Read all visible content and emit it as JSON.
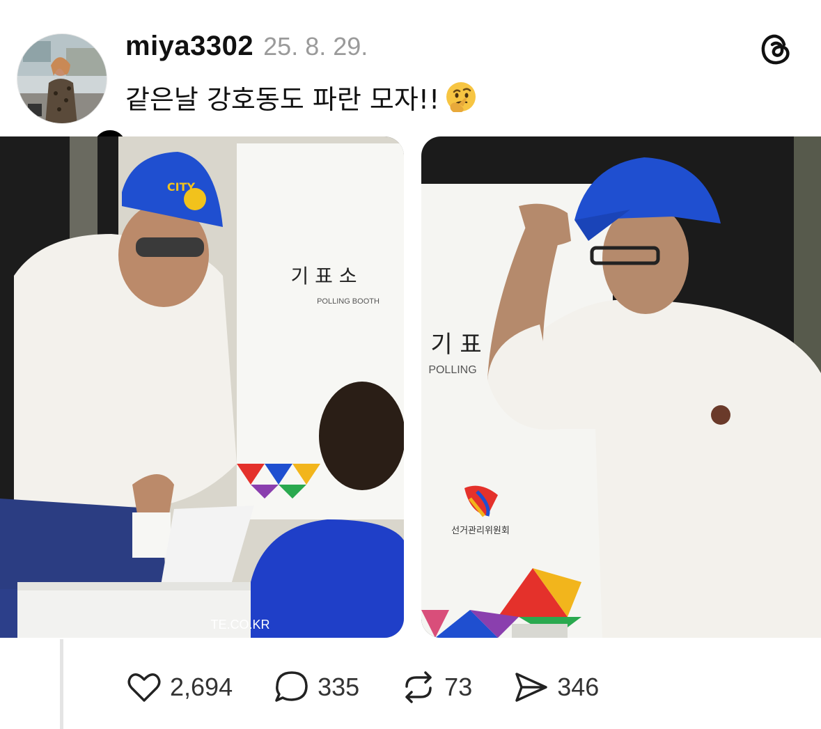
{
  "post": {
    "username": "miya3302",
    "timestamp": "25. 8. 29.",
    "caption": "같은날 강호동도 파란 모자!!",
    "caption_emoji": "thinking-face-emoji",
    "follow_symbol": "+"
  },
  "app": {
    "logo_icon": "threads-logo-icon"
  },
  "images": [
    {
      "name": "polling-photo-left",
      "booth_title": "기 표 소",
      "booth_subtitle": "POLLING BOOTH",
      "cap_text": "CITY",
      "watermark": "TE.CO.KR"
    },
    {
      "name": "polling-photo-right",
      "booth_title": "기 표",
      "booth_subtitle": "POLLING",
      "committee": "선거관리위원회"
    }
  ],
  "actions": {
    "likes": "2,694",
    "replies": "335",
    "reposts": "73",
    "shares": "346"
  },
  "colors": {
    "cap_blue": "#1f4fd0",
    "shirt_white": "#f3f1ec",
    "username": "#111111",
    "timestamp": "#9a9a9a",
    "count_text": "#333333"
  }
}
